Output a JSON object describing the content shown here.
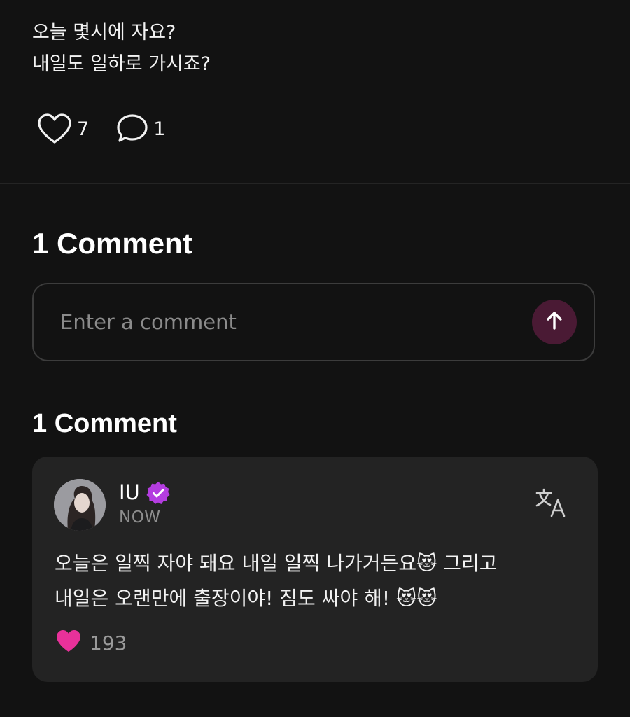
{
  "post": {
    "lines": [
      "오늘 몇시에 자요?",
      "내일도 일하로 가시죠?"
    ],
    "like_count": "7",
    "comment_count": "1"
  },
  "comments_header": "1 Comment",
  "input": {
    "placeholder": "Enter a comment"
  },
  "comments_list_header": "1 Comment",
  "comment": {
    "author": "IU",
    "timestamp": "NOW",
    "lines": [
      "오늘은 일찍 자야 돼요 내일 일찍 나가거든요😻 그리고",
      "내일은 오랜만에 출장이야! 짐도 싸야 해! 😻😻"
    ],
    "like_count": "193"
  },
  "colors": {
    "background": "#121212",
    "card": "#232323",
    "accent": "#4a1a34",
    "like_pink": "#e8319a",
    "verified_purple": "#b43de0"
  },
  "icons": {
    "like": "heart-outline-icon",
    "comment": "speech-bubble-icon",
    "send": "arrow-up-icon",
    "verified": "verified-badge-icon",
    "translate": "translate-icon",
    "comment_like": "heart-filled-icon"
  }
}
